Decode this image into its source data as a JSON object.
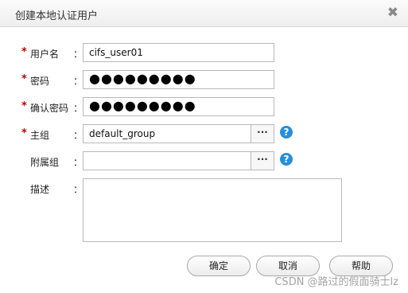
{
  "dialog": {
    "title": "创建本地认证用户",
    "close_glyph": "✖"
  },
  "form": {
    "username": {
      "required": "*",
      "label": "用户名",
      "colon": "：",
      "value": "cifs_user01"
    },
    "password": {
      "required": "*",
      "label": "密码",
      "colon": "：",
      "value": "●●●●●●●●●"
    },
    "confirm_password": {
      "required": "*",
      "label": "确认密码",
      "colon": "：",
      "value": "●●●●●●●●●"
    },
    "primary_group": {
      "required": "*",
      "label": "主组",
      "colon": "：",
      "value": "default_group",
      "browse_glyph": "···",
      "help_glyph": "?"
    },
    "secondary_group": {
      "label": "附属组",
      "colon": "：",
      "value": "",
      "browse_glyph": "···",
      "help_glyph": "?"
    },
    "description": {
      "label": "描述",
      "colon": "：",
      "value": ""
    }
  },
  "buttons": {
    "ok": "确定",
    "cancel": "取消",
    "help": "帮助"
  },
  "watermark": "CSDN @路过的假面骑士lz",
  "colors": {
    "required": "#c00000",
    "help_icon": "#2a8fd8"
  }
}
